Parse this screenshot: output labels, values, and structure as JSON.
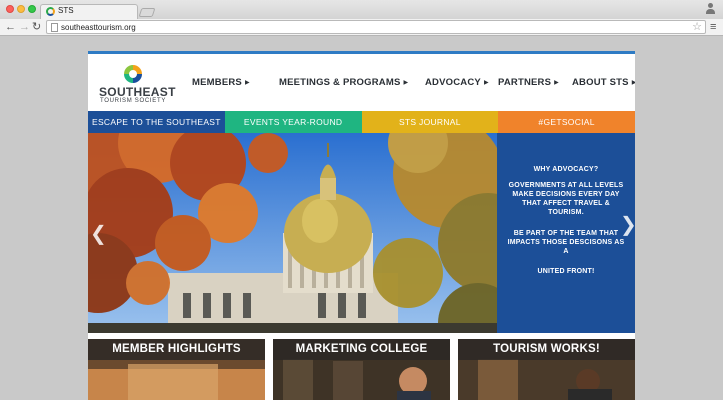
{
  "browser": {
    "tab_title": "STS",
    "url": "southeasttourism.org",
    "back_label": "←",
    "forward_label": "→",
    "reload_label": "↻",
    "star_label": "☆",
    "menu_label": "≡"
  },
  "site": {
    "logo": {
      "line1": "SOUTHEAST",
      "line2": "TOURISM SOCIETY"
    },
    "nav": [
      {
        "label": "MEMBERS",
        "arrow": "▶"
      },
      {
        "label": "MEETINGS & PROGRAMS",
        "arrow": "▶"
      },
      {
        "label": "ADVOCACY",
        "arrow": "▶"
      },
      {
        "label": "PARTNERS",
        "arrow": "▶"
      },
      {
        "label": "ABOUT STS",
        "arrow": "▶"
      }
    ],
    "colorbar": [
      {
        "label": "ESCAPE TO THE SOUTHEAST",
        "color": "#1c4f98"
      },
      {
        "label": "EVENTS YEAR-ROUND",
        "color": "#1fb581"
      },
      {
        "label": "STS JOURNAL",
        "color": "#e2b21a"
      },
      {
        "label": "#GETSOCIAL",
        "color": "#f0832b"
      }
    ],
    "slider": {
      "prev_label": "❮",
      "next_label": "❯",
      "panel": {
        "heading": "WHY ADVOCACY?",
        "p1": "GOVERNMENTS AT ALL LEVELS MAKE DECISIONS EVERY DAY THAT AFFECT TRAVEL & TOURISM.",
        "p2": "BE PART OF THE TEAM THAT IMPACTS THOSE DESCISONS AS A",
        "p3": "UNITED FRONT!"
      }
    },
    "cards": [
      {
        "label": "MEMBER HIGHLIGHTS"
      },
      {
        "label": "MARKETING COLLEGE"
      },
      {
        "label": "TOURISM WORKS!"
      }
    ]
  }
}
